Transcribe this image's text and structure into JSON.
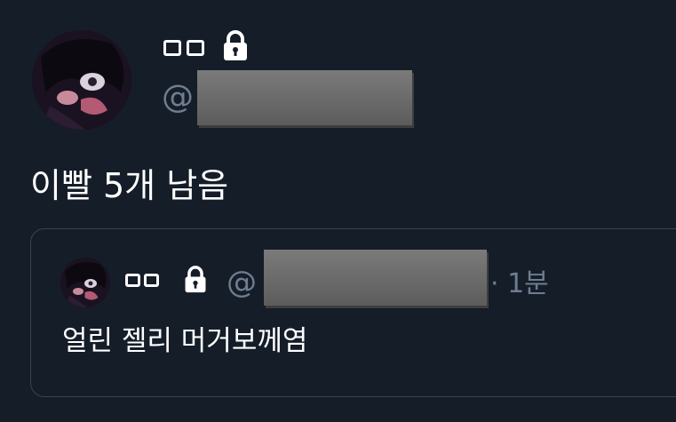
{
  "tweet": {
    "author": {
      "display_name": "ㅁㅁ",
      "handle_prefix": "@"
    },
    "text": "이빨 5개 남음"
  },
  "quoted_tweet": {
    "author": {
      "display_name": "ㅁㅁ",
      "handle_prefix": "@"
    },
    "time": "· 1분",
    "text": "얼린 젤리 머거보께염"
  },
  "colors": {
    "background": "#151d29",
    "secondary_text": "#6e7d8f",
    "border": "#38444d",
    "redaction": "#6a6a6a"
  },
  "icons": {
    "lock": "lock-icon"
  }
}
